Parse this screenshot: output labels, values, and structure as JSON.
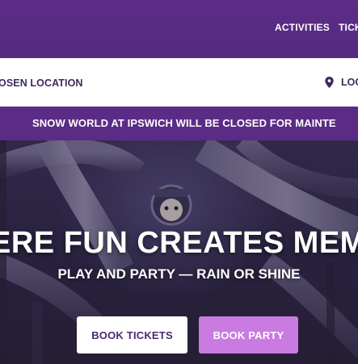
{
  "nav": {
    "items": [
      {
        "label": "ACTIVITIES"
      },
      {
        "label": "TICK"
      }
    ]
  },
  "location_bar": {
    "chosen_location": "OSEN LOCATION",
    "location_link": "LOC",
    "icon": "map-pin-icon"
  },
  "notice": {
    "text": "SNOW WORLD AT IPSWICH WILL BE CLOSED FOR MAINTE"
  },
  "hero": {
    "title": "ERE FUN CREATES MEMO",
    "subtitle": "PLAY AND PARTY — RAIN OR SHINE",
    "buttons": {
      "tickets": "BOOK TICKETS",
      "party": "BOOK PARTY"
    }
  },
  "colors": {
    "brand_purple": "#5b2c86",
    "party_button": "#c97be2",
    "text_dark": "#3e2a5c"
  }
}
